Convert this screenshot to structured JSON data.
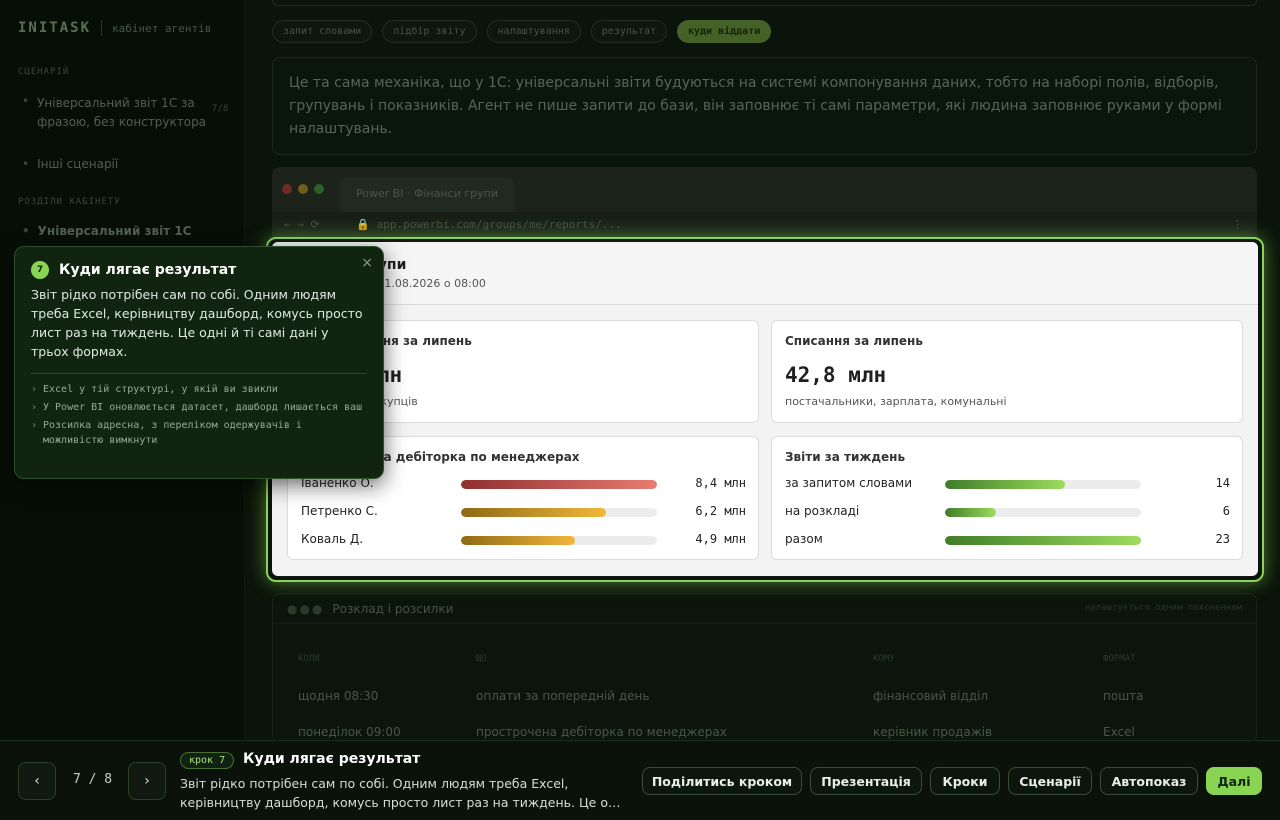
{
  "sidebar": {
    "logo": "INITASK",
    "subtitle": "кабінет агентів",
    "section_scenario": "СЦЕНАРІЙ",
    "scenario_items": [
      {
        "label": "Універсальний звіт 1С за фразою, без конструктора",
        "count": "7/8"
      },
      {
        "label": "Інші сценарії"
      }
    ],
    "section_modules": "РОЗДІЛИ КАБІНЕТУ",
    "module_items": [
      {
        "label": "Універсальний звіт 1С"
      }
    ]
  },
  "chips": [
    "запит словами",
    "підбір звіту",
    "налаштування",
    "результат",
    "куди віддати"
  ],
  "intro_text": "Це та сама механіка, що у 1С: універсальні звіти будуються на системі компонування даних, тобто на наборі полів, відборів, групувань і показників. Агент не пише запити до бази, він заповнює ті самі параметри, які людина заповнює руками у формі налаштувань.",
  "browser": {
    "tab_title": "Power BI · Фінанси групи",
    "nav": "← → ⟳",
    "url": "🔒 app.powerbi.com/groups/me/reports/...",
    "menu": "⋮"
  },
  "report": {
    "title": "Фінанси групи",
    "updated": "Дані оновлено 01.08.2026 о 08:00",
    "kpi_left": {
      "title": "Надходження за липень",
      "value": "61,4 млн",
      "sub": "оплати від покупців"
    },
    "kpi_right": {
      "title": "Списання за липень",
      "value": "42,8 млн",
      "sub": "постачальники, зарплата, комунальні"
    },
    "debt": {
      "title": "Прострочена дебіторка по менеджерах",
      "rows": [
        {
          "name": "Іваненко О.",
          "value": "8,4 млн",
          "fraction": 1.0,
          "color_from": "#8e2f2f",
          "color_to": "#ea7b72"
        },
        {
          "name": "Петренко С.",
          "value": "6,2 млн",
          "fraction": 0.74,
          "color_from": "#8e6a15",
          "color_to": "#f1b73a"
        },
        {
          "name": "Коваль Д.",
          "value": "4,9 млн",
          "fraction": 0.58,
          "color_from": "#8e6a15",
          "color_to": "#f1b73a"
        }
      ]
    },
    "reports": {
      "title": "Звіти за тиждень",
      "rows": [
        {
          "name": "за запитом словами",
          "value": "14",
          "fraction": 0.61,
          "color_from": "#3f7c28",
          "color_to": "#9ddc5e"
        },
        {
          "name": "на розкладі",
          "value": "6",
          "fraction": 0.26,
          "color_from": "#3f7c28",
          "color_to": "#9ddc5e"
        },
        {
          "name": "разом",
          "value": "23",
          "fraction": 1.0,
          "color_from": "#3f7c28",
          "color_to": "#9ddc5e"
        }
      ]
    }
  },
  "schedule": {
    "title": "Розклад і розсилки",
    "right_label": "налаштується одним поясненням",
    "columns": [
      "КОЛИ",
      "ЩО",
      "КОМУ",
      "ФОРМАТ"
    ],
    "rows": [
      [
        "щодня 08:30",
        "оплати за попередній день",
        "фінансовий відділ",
        "пошта"
      ],
      [
        "понеділок 09:00",
        "прострочена дебіторка по менеджерах",
        "керівник продажів",
        "Excel"
      ]
    ]
  },
  "tooltip": {
    "number": "7",
    "title": "Куди лягає результат",
    "body": "Звіт рідко потрібен сам по собі. Одним людям треба Excel, керівництву дашборд, комусь просто лист раз на тиждень. Це одні й ті самі дані у трьох формах.",
    "bullet_glyph": "›",
    "items": [
      "Excel у тій структурі, у якій ви звикли",
      "У Power BI оновлюється датасет, дашборд лишається ваш",
      "Розсилка адресна, з переліком одержувачів і можливістю вимкнути"
    ],
    "close": "×"
  },
  "bottom": {
    "prev": "‹",
    "next": "›",
    "pager": "7 / 8",
    "step_badge": "крок 7",
    "step_title": "Куди лягає результат",
    "step_text": "Звіт рідко потрібен сам по собі. Одним людям треба Excel, керівництву дашборд, комусь просто лист раз на тиждень. Це о…",
    "buttons": {
      "share": "Поділитись кроком",
      "presentation": "Презентація",
      "steps": "Кроки",
      "scenarios": "Сценарії",
      "autoplay": "Автопоказ",
      "next": "Далі"
    }
  },
  "colors": {
    "accent": "#8ad454",
    "background": "#050b05",
    "panel": "#102410"
  }
}
